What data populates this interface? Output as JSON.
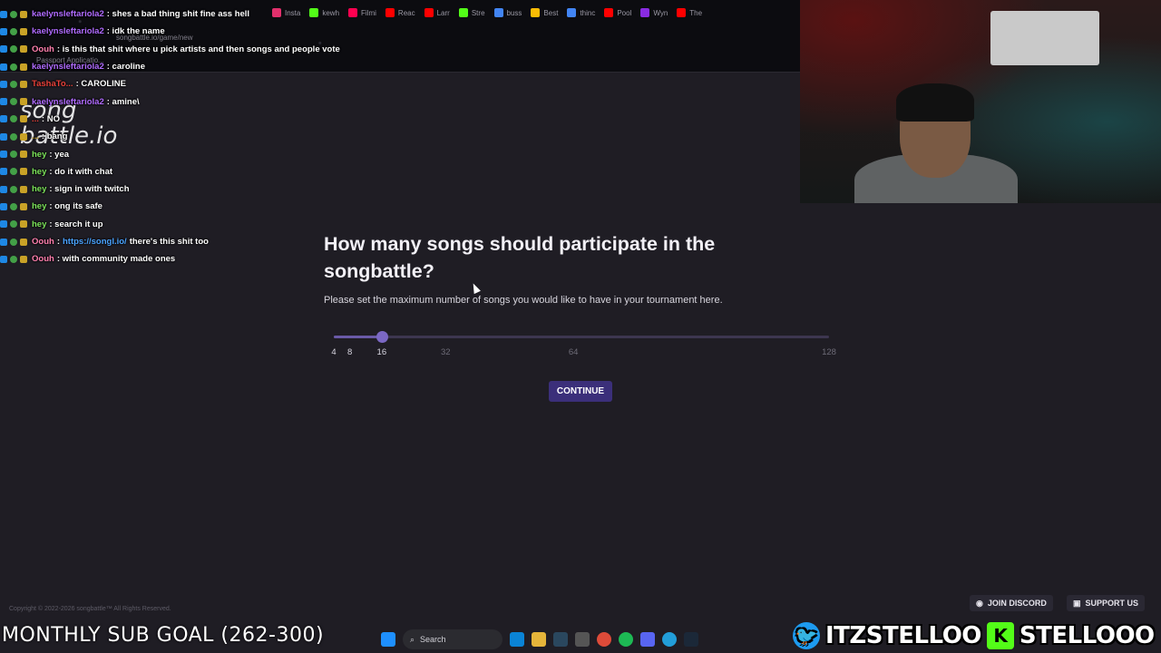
{
  "browser": {
    "url": "songbattle.io/game/new",
    "tab_hint": "Passport Applicatio...",
    "bookmarks": [
      "Insta",
      "kewh",
      "Filmi",
      "Reac",
      "Larr",
      "Stre",
      "buss",
      "Best",
      "thinc",
      "Pool",
      "Wyn",
      "The"
    ]
  },
  "logo": {
    "line1": "song",
    "line2": "battle.io"
  },
  "chat": [
    {
      "user": "kaelynsleftariola2",
      "color": "#b06bff",
      "text": ": shes a bad thing shit fine ass hell"
    },
    {
      "user": "kaelynsleftariola2",
      "color": "#b06bff",
      "text": ": idk the name"
    },
    {
      "user": "Oouh",
      "color": "#ff7fae",
      "text": ": is this that shit where u pick artists and then songs and people vote"
    },
    {
      "user": "kaelynsleftariola2",
      "color": "#b06bff",
      "text": ": caroline"
    },
    {
      "user": "TashaTo...",
      "color": "#e8413a",
      "text": ": CAROLINE"
    },
    {
      "user": "kaelynsleftariola2",
      "color": "#b06bff",
      "text": ": amine\\"
    },
    {
      "user": "...",
      "color": "#e8413a",
      "text": ": NO"
    },
    {
      "user": "...",
      "color": "#c9a227",
      "text": ": bang"
    },
    {
      "user": "hey",
      "color": "#7ce35a",
      "text": ": yea"
    },
    {
      "user": "hey",
      "color": "#7ce35a",
      "text": ": do it with chat"
    },
    {
      "user": "hey",
      "color": "#7ce35a",
      "text": ": sign in with twitch"
    },
    {
      "user": "hey",
      "color": "#7ce35a",
      "text": ": ong its safe"
    },
    {
      "user": "hey",
      "color": "#7ce35a",
      "text": ": search it up"
    },
    {
      "user": "Oouh",
      "color": "#ff7fae",
      "text": ": ",
      "link": "https://songl.io/",
      "after": " there's this shit too"
    },
    {
      "user": "Oouh",
      "color": "#ff7fae",
      "text": ": with community made ones"
    }
  ],
  "setup": {
    "question": "How many songs should participate in the songbattle?",
    "hint": "Please set the maximum number of songs you would like to have in your tournament here.",
    "slider": {
      "min": 4,
      "max": 128,
      "value": 16,
      "ticks": [
        "4",
        "8",
        "16",
        "32",
        "64",
        "128"
      ],
      "tick_values": [
        4,
        8,
        16,
        32,
        64,
        128
      ]
    },
    "continue_label": "CONTINUE"
  },
  "footer": {
    "copyright": "Copyright © 2022-2026 songbattle™ All Rights Reserved.",
    "discord_label": "JOIN DISCORD",
    "support_label": "SUPPORT US"
  },
  "stream": {
    "sub_goal": "MONTHLY SUB GOAL (262-300)",
    "twitter_handle": "ITZSTELLOO",
    "kick_handle": "STELLOOO",
    "taskbar_search": "Search"
  },
  "colors": {
    "accent": "#6a5aa8",
    "button": "#3b2f7a",
    "background": "#1f1d24"
  }
}
